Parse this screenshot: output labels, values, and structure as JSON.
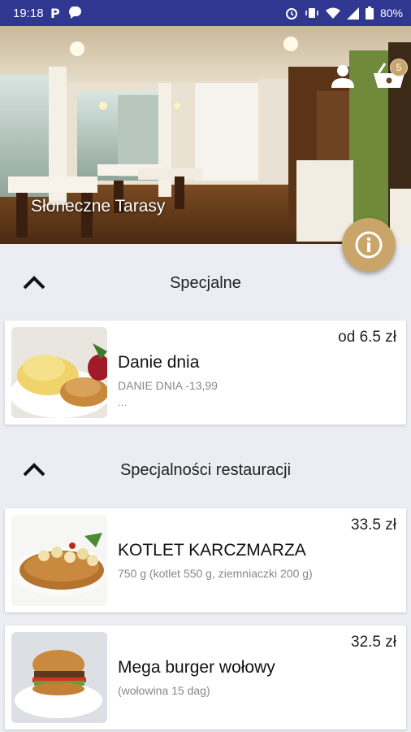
{
  "status_bar": {
    "time": "19:18",
    "battery": "80%",
    "icons_left": [
      "parking-icon",
      "chat-bubble-icon"
    ],
    "icons_right": [
      "alarm-icon",
      "vibrate-icon",
      "wifi-icon",
      "signal-icon",
      "battery-icon"
    ]
  },
  "hero": {
    "restaurant_name": "Słoneczne Tarasy",
    "cart_count": "5"
  },
  "colors": {
    "status_bar": "#2F3791",
    "accent_gold": "#C9A56A",
    "background": "#ECEDF3"
  },
  "sections": [
    {
      "title": "Specjalne",
      "items": [
        {
          "name": "Danie dnia",
          "description": "DANIE DNIA -13,99",
          "extra": "...",
          "price": "od 6.5 zł"
        }
      ]
    },
    {
      "title": "Specjalności restauracji",
      "items": [
        {
          "name": "KOTLET KARCZMARZA",
          "description": "750 g  (kotlet 550 g, ziemniaczki 200 g)",
          "price": "33.5 zł"
        },
        {
          "name": "Mega burger wołowy",
          "description": "(wołowina 15 dag)",
          "price": "32.5 zł"
        }
      ]
    }
  ]
}
